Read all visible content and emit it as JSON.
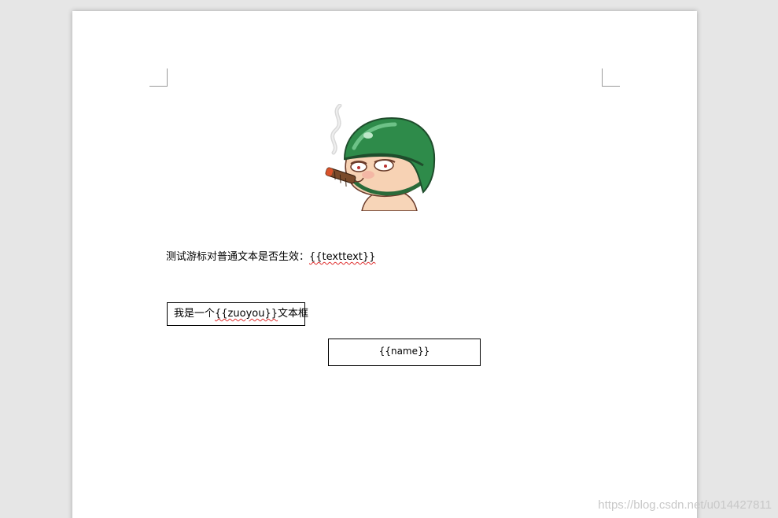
{
  "document": {
    "body_prefix": "测试游标对普通文本是否生效：",
    "body_placeholder": "{{texttext}}",
    "textbox1": {
      "prefix": "我是一个",
      "placeholder": "{{zuoyou}}",
      "suffix": "文本框"
    },
    "textbox2": {
      "text": "{{name}}"
    }
  },
  "watermark": "https://blog.csdn.net/u014427811",
  "image": {
    "description_icon": "soldier-cartoon-icon"
  },
  "colors": {
    "page_background": "#ffffff",
    "workspace_background": "#e6e6e6",
    "spellcheck_underline": "#e03030",
    "helmet_green": "#2e8b4a"
  }
}
